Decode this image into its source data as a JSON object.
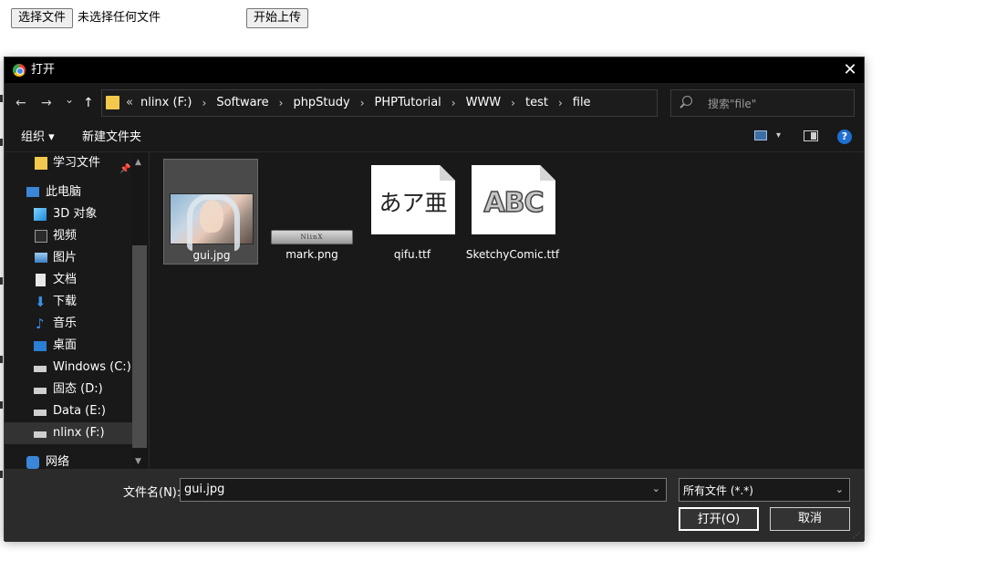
{
  "page": {
    "choose_button": "选择文件",
    "no_file_text": "未选择任何文件",
    "upload_button": "开始上传"
  },
  "dialog": {
    "title": "打开",
    "close": "✕",
    "nav": {
      "back": "←",
      "forward": "→",
      "recent": "⌄",
      "up": "↑"
    },
    "breadcrumb_lead": "«",
    "breadcrumbs": [
      "nlinx (F:)",
      "Software",
      "phpStudy",
      "PHPTutorial",
      "WWW",
      "test",
      "file"
    ],
    "breadcrumb_sep": "›",
    "search_placeholder": "搜索\"file\"",
    "toolbar": {
      "organize": "组织 ▾",
      "new_folder": "新建文件夹",
      "help": "?"
    },
    "sidebar": [
      {
        "label": "学习文件",
        "icon": "folder-icon"
      },
      {
        "label": "此电脑",
        "icon": "computer-icon"
      },
      {
        "label": "3D 对象",
        "icon": "cube-icon"
      },
      {
        "label": "视频",
        "icon": "video-icon"
      },
      {
        "label": "图片",
        "icon": "pictures-icon"
      },
      {
        "label": "文档",
        "icon": "document-icon"
      },
      {
        "label": "下载",
        "icon": "download-icon"
      },
      {
        "label": "音乐",
        "icon": "music-icon"
      },
      {
        "label": "桌面",
        "icon": "desktop-icon"
      },
      {
        "label": "Windows (C:)",
        "icon": "drive-icon"
      },
      {
        "label": "固态 (D:)",
        "icon": "drive-icon"
      },
      {
        "label": "Data (E:)",
        "icon": "drive-icon"
      },
      {
        "label": "nlinx (F:)",
        "icon": "drive-icon"
      },
      {
        "label": "网络",
        "icon": "network-icon"
      }
    ],
    "files": [
      {
        "name": "gui.jpg",
        "selected": true
      },
      {
        "name": "mark.png",
        "thumb_text": "NlinX"
      },
      {
        "name": "qifu.ttf",
        "thumb_text": "あア亜"
      },
      {
        "name": "SketchyComic.ttf",
        "thumb_text": "ABC"
      }
    ],
    "filename_label": "文件名(N):",
    "filename_value": "gui.jpg",
    "filetype_value": "所有文件 (*.*)",
    "open_button": "打开(O)",
    "cancel_button": "取消"
  },
  "colors": {
    "dialog_bg": "#191919",
    "titlebar": "#000000",
    "footer_bg": "#2b2b2b",
    "accent_folder": "#f2c94c",
    "help_blue": "#1f6fd1"
  }
}
